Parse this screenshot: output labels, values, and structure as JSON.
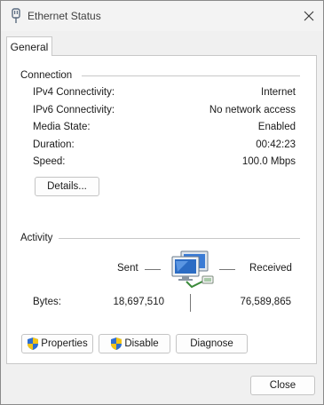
{
  "window": {
    "title": "Ethernet Status",
    "icon": "ethernet-icon",
    "close_icon": "close-icon"
  },
  "tabs": [
    {
      "label": "General"
    }
  ],
  "connection": {
    "group_label": "Connection",
    "rows": [
      {
        "label": "IPv4 Connectivity:",
        "value": "Internet"
      },
      {
        "label": "IPv6 Connectivity:",
        "value": "No network access"
      },
      {
        "label": "Media State:",
        "value": "Enabled"
      },
      {
        "label": "Duration:",
        "value": "00:42:23"
      },
      {
        "label": "Speed:",
        "value": "100.0 Mbps"
      }
    ],
    "details_button": "Details..."
  },
  "activity": {
    "group_label": "Activity",
    "sent_label": "Sent",
    "received_label": "Received",
    "bytes_label": "Bytes:",
    "bytes_sent": "18,697,510",
    "bytes_received": "76,589,865",
    "icon": "network-computers-icon"
  },
  "buttons": {
    "properties": "Properties",
    "disable": "Disable",
    "diagnose": "Diagnose",
    "close": "Close"
  },
  "colors": {
    "shield_blue": "#2f6fd0",
    "shield_yellow": "#f2c417",
    "background": "#f0f0f0",
    "panel": "#ffffff"
  }
}
